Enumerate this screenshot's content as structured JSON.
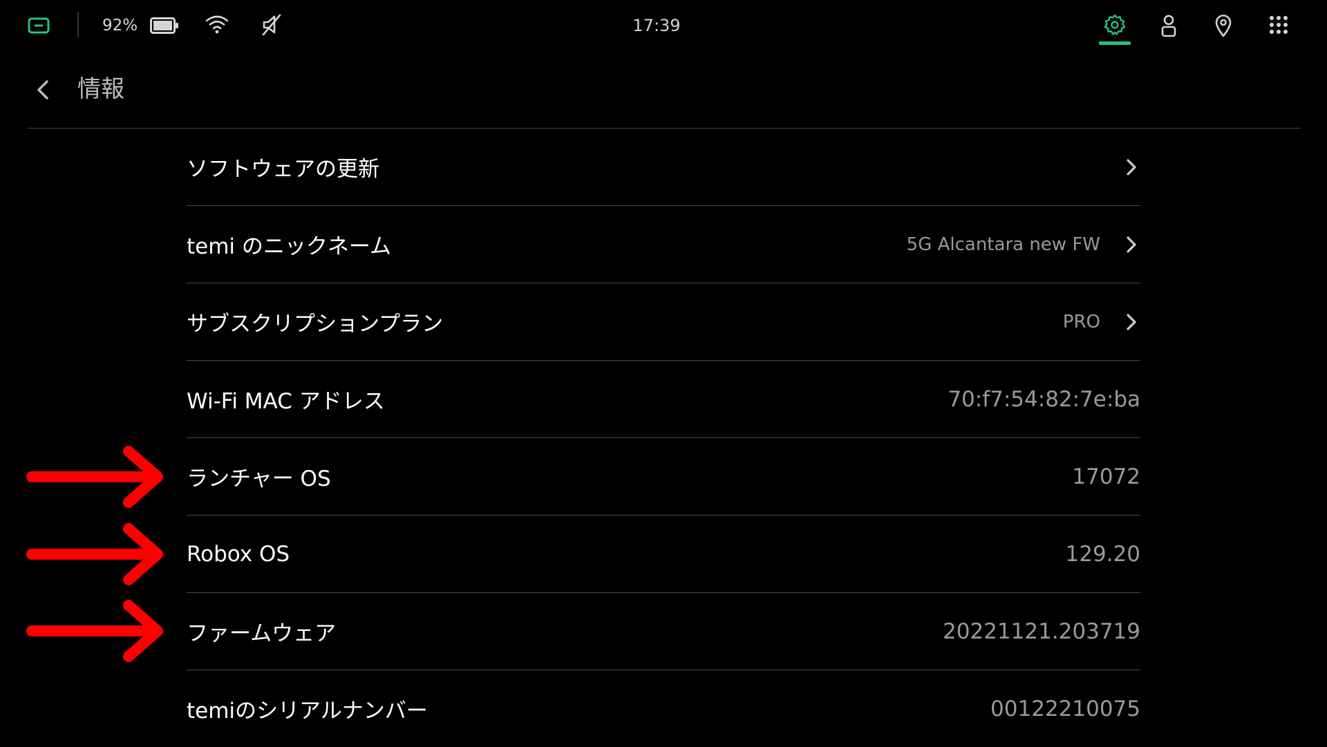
{
  "status_bar": {
    "battery_percent": "92%",
    "time": "17:39",
    "accent_color": "#25c08f",
    "icons": [
      "screen-icon",
      "battery-icon",
      "wifi-icon",
      "mute-icon",
      "settings-icon",
      "user-icon",
      "location-icon",
      "apps-icon"
    ]
  },
  "header": {
    "title": "情報",
    "back_icon": "chevron-left-icon"
  },
  "settings": {
    "items": [
      {
        "label": "ソフトウェアの更新",
        "value": ""
      },
      {
        "label": "temi のニックネーム",
        "value": "5G Alcantara new FW"
      },
      {
        "label": "サブスクリプションプラン",
        "value": "PRO"
      },
      {
        "label": "Wi-Fi MAC アドレス",
        "value": "70:f7:54:82:7e:ba"
      },
      {
        "label": "ランチャー OS",
        "value": "17072"
      },
      {
        "label": "Robox OS",
        "value": "129.20"
      },
      {
        "label": "ファームウェア",
        "value": "20221121.203719"
      },
      {
        "label": "temiのシリアルナンバー",
        "value": "00122210075"
      }
    ]
  },
  "annotations": {
    "arrow_color": "#ff0000",
    "highlighted_items": [
      "ランチャー OS",
      "Robox OS",
      "ファームウェア"
    ]
  }
}
